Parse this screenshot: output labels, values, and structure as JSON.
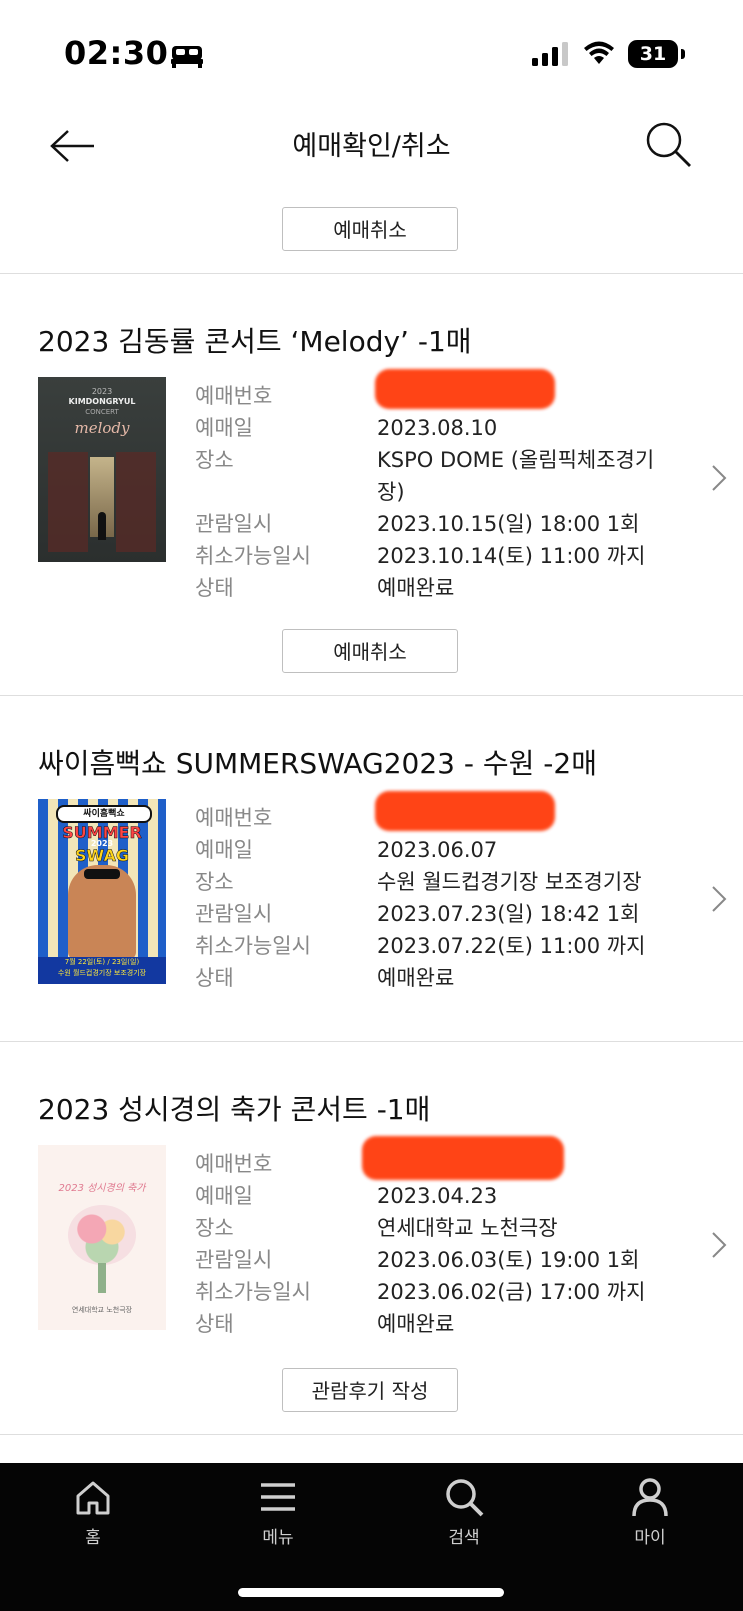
{
  "status_bar": {
    "time": "02:30",
    "battery": "31"
  },
  "header": {
    "title": "예매확인/취소"
  },
  "top_button": "예매취소",
  "reservations": [
    {
      "title": "2023 김동률 콘서트 ‘Melody’ -1매",
      "poster": {
        "line1": "2023",
        "line2": "KIMDONGRYUL",
        "line3": "CONCERT",
        "line4": "melody"
      },
      "labels": {
        "number": "예매번호",
        "date": "예매일",
        "venue": "장소",
        "showtime": "관람일시",
        "cancel_deadline": "취소가능일시",
        "status": "상태"
      },
      "values": {
        "number": "",
        "date": "2023.08.10",
        "venue": "KSPO DOME (올림픽체조경기장)",
        "showtime": "2023.10.15(일) 18:00 1회",
        "cancel_deadline": "2023.10.14(토) 11:00 까지",
        "status": "예매완료"
      },
      "button": "예매취소"
    },
    {
      "title": "싸이흠뻑쇼 SUMMERSWAG2023 - 수원 -2매",
      "poster": {
        "line1": "싸이흠뻑쇼",
        "line2": "SUMMER",
        "line3": "2023",
        "line4": "SWAG",
        "line5": "7월 22일(토) / 23일(일)",
        "line6": "수원 월드컵경기장 보조경기장"
      },
      "labels": {
        "number": "예매번호",
        "date": "예매일",
        "venue": "장소",
        "showtime": "관람일시",
        "cancel_deadline": "취소가능일시",
        "status": "상태"
      },
      "values": {
        "number": "",
        "date": "2023.06.07",
        "venue": "수원 월드컵경기장 보조경기장",
        "showtime": "2023.07.23(일) 18:42 1회",
        "cancel_deadline": "2023.07.22(토) 11:00 까지",
        "status": "예매완료"
      }
    },
    {
      "title": "2023 성시경의 축가 콘서트 -1매",
      "poster": {
        "line1": "2023 성시경의 축가",
        "line2": "연세대학교 노천극장"
      },
      "labels": {
        "number": "예매번호",
        "date": "예매일",
        "venue": "장소",
        "showtime": "관람일시",
        "cancel_deadline": "취소가능일시",
        "status": "상태"
      },
      "values": {
        "number": "",
        "date": "2023.04.23",
        "venue": "연세대학교 노천극장",
        "showtime": "2023.06.03(토) 19:00 1회",
        "cancel_deadline": "2023.06.02(금) 17:00 까지",
        "status": "예매완료"
      },
      "button": "관람후기 작성"
    }
  ],
  "tabbar": [
    {
      "label": "홈",
      "icon": "home-icon"
    },
    {
      "label": "메뉴",
      "icon": "menu-icon"
    },
    {
      "label": "검색",
      "icon": "search-icon"
    },
    {
      "label": "마이",
      "icon": "person-icon"
    }
  ],
  "colors": {
    "redaction": "#ff3b0a",
    "tabbar_bg": "#050505"
  }
}
